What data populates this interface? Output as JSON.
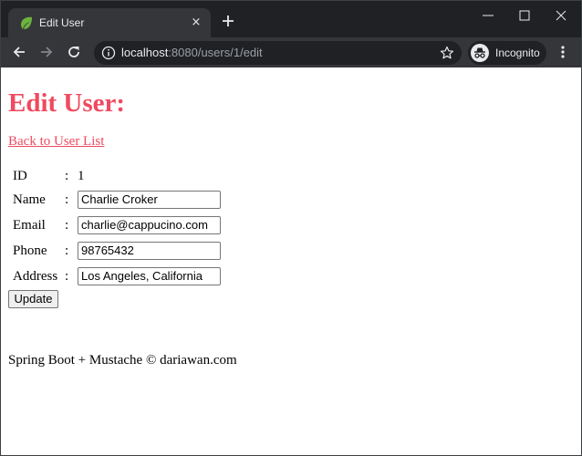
{
  "browser": {
    "tab": {
      "title": "Edit User",
      "close": "×"
    },
    "url": {
      "host": "localhost",
      "path": ":8080/users/1/edit"
    },
    "incognito_label": "Incognito"
  },
  "page": {
    "title": "Edit User:",
    "back_link": "Back to User List",
    "form": {
      "id": {
        "label": "ID",
        "value": "1"
      },
      "name": {
        "label": "Name",
        "value": "Charlie Croker"
      },
      "email": {
        "label": "Email",
        "value": "charlie@cappucino.com"
      },
      "phone": {
        "label": "Phone",
        "value": "98765432"
      },
      "address": {
        "label": "Address",
        "value": "Los Angeles, California"
      },
      "separator": ":",
      "submit_label": "Update"
    },
    "footer": "Spring Boot + Mustache © dariawan.com"
  },
  "colors": {
    "accent": "#ef4a5f",
    "chrome_dark": "#202124",
    "chrome_toolbar": "#35363a",
    "spring_green": "#6db33f"
  },
  "icons": {
    "favicon": "spring-leaf-icon",
    "new_tab": "plus-icon",
    "back": "arrow-left-icon",
    "forward": "arrow-right-icon",
    "reload": "reload-icon",
    "info": "info-icon",
    "bookmark": "star-icon",
    "incognito": "incognito-icon",
    "menu": "kebab-menu-icon"
  }
}
